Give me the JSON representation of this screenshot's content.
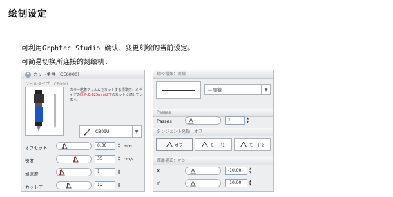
{
  "heading": "绘制设定",
  "paragraphs": [
    "可利用Grphtec Studio 确认、变更刻绘的当前设定。",
    "可简易切换所连接的刻绘机."
  ],
  "left_panel": {
    "title": "カット条件（CE6000）",
    "tool_type_label": "ツールタイプ：CB09U",
    "tool_description_pre": "カラー粘着フィルムをカットする標準刃：メディアの",
    "tool_description_red": "厚み:0.025mm以下",
    "tool_description_post": "のカットに適しています。",
    "tool_select_value": "CB09U",
    "fields": [
      {
        "label": "オフセット",
        "value": "0.00",
        "unit": "mm",
        "level": 0.12
      },
      {
        "label": "速度",
        "value": "35",
        "unit": "cm/s",
        "level": 0.55
      },
      {
        "label": "加速度",
        "value": "1",
        "unit": "",
        "level": 0.02
      },
      {
        "label": "カット圧",
        "value": "12",
        "unit": "",
        "level": 0.3
      }
    ]
  },
  "right_panel": {
    "line_section_label": "線の種類：実線",
    "line_type_value": "実線",
    "passes_section_label": "Passes",
    "passes_label": "Passes",
    "passes_value": "1",
    "passes_level": 0.02,
    "tangent_section_label": "タンジェント発動：オフ",
    "tangent_modes": [
      "オフ",
      "モード1",
      "モード2"
    ],
    "distance_section_label": "距離補正：オン",
    "x_label": "X",
    "x_value": "-10.00",
    "y_label": "Y",
    "y_value": "-10.00"
  }
}
